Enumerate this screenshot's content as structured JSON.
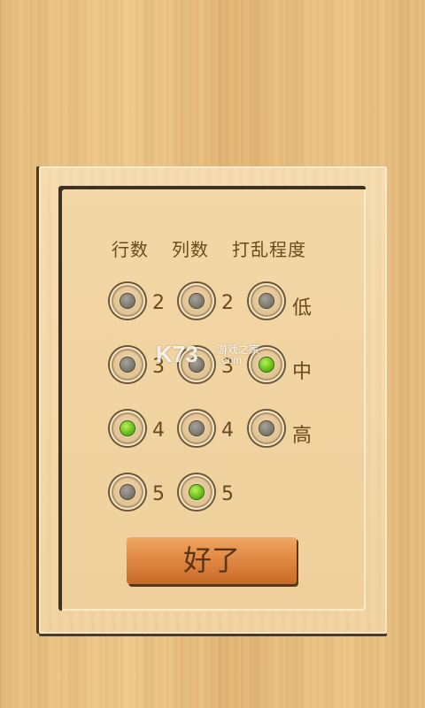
{
  "headers": {
    "rows": "行数",
    "cols": "列数",
    "shuffle": "打乱程度"
  },
  "rows_options": [
    {
      "label": "2",
      "selected": false
    },
    {
      "label": "3",
      "selected": false
    },
    {
      "label": "4",
      "selected": true
    },
    {
      "label": "5",
      "selected": false
    }
  ],
  "cols_options": [
    {
      "label": "2",
      "selected": false
    },
    {
      "label": "3",
      "selected": false
    },
    {
      "label": "4",
      "selected": false
    },
    {
      "label": "5",
      "selected": true
    }
  ],
  "shuffle_options": [
    {
      "label": "低",
      "selected": false
    },
    {
      "label": "中",
      "selected": true
    },
    {
      "label": "高",
      "selected": false
    }
  ],
  "ok_button": "好了",
  "watermark": {
    "logo": "K73",
    "text": "游戏之家",
    "domain": ".com"
  },
  "colors": {
    "selected": "#6cc21c",
    "unselected": "#7e7a70",
    "button": "#e08a45",
    "text": "#6b4a1e"
  }
}
